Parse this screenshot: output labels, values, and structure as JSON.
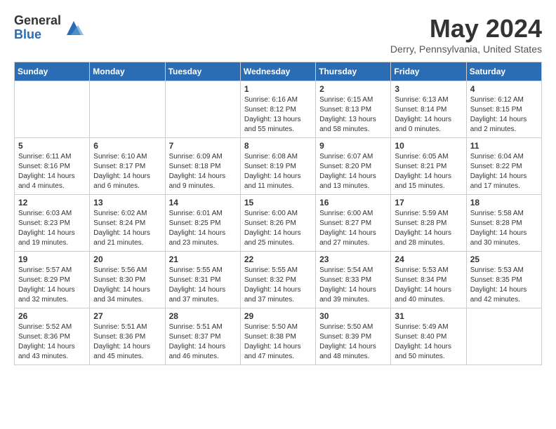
{
  "header": {
    "logo_general": "General",
    "logo_blue": "Blue",
    "title": "May 2024",
    "location": "Derry, Pennsylvania, United States"
  },
  "days_of_week": [
    "Sunday",
    "Monday",
    "Tuesday",
    "Wednesday",
    "Thursday",
    "Friday",
    "Saturday"
  ],
  "weeks": [
    [
      {
        "day": "",
        "sunrise": "",
        "sunset": "",
        "daylight": ""
      },
      {
        "day": "",
        "sunrise": "",
        "sunset": "",
        "daylight": ""
      },
      {
        "day": "",
        "sunrise": "",
        "sunset": "",
        "daylight": ""
      },
      {
        "day": "1",
        "sunrise": "Sunrise: 6:16 AM",
        "sunset": "Sunset: 8:12 PM",
        "daylight": "Daylight: 13 hours and 55 minutes."
      },
      {
        "day": "2",
        "sunrise": "Sunrise: 6:15 AM",
        "sunset": "Sunset: 8:13 PM",
        "daylight": "Daylight: 13 hours and 58 minutes."
      },
      {
        "day": "3",
        "sunrise": "Sunrise: 6:13 AM",
        "sunset": "Sunset: 8:14 PM",
        "daylight": "Daylight: 14 hours and 0 minutes."
      },
      {
        "day": "4",
        "sunrise": "Sunrise: 6:12 AM",
        "sunset": "Sunset: 8:15 PM",
        "daylight": "Daylight: 14 hours and 2 minutes."
      }
    ],
    [
      {
        "day": "5",
        "sunrise": "Sunrise: 6:11 AM",
        "sunset": "Sunset: 8:16 PM",
        "daylight": "Daylight: 14 hours and 4 minutes."
      },
      {
        "day": "6",
        "sunrise": "Sunrise: 6:10 AM",
        "sunset": "Sunset: 8:17 PM",
        "daylight": "Daylight: 14 hours and 6 minutes."
      },
      {
        "day": "7",
        "sunrise": "Sunrise: 6:09 AM",
        "sunset": "Sunset: 8:18 PM",
        "daylight": "Daylight: 14 hours and 9 minutes."
      },
      {
        "day": "8",
        "sunrise": "Sunrise: 6:08 AM",
        "sunset": "Sunset: 8:19 PM",
        "daylight": "Daylight: 14 hours and 11 minutes."
      },
      {
        "day": "9",
        "sunrise": "Sunrise: 6:07 AM",
        "sunset": "Sunset: 8:20 PM",
        "daylight": "Daylight: 14 hours and 13 minutes."
      },
      {
        "day": "10",
        "sunrise": "Sunrise: 6:05 AM",
        "sunset": "Sunset: 8:21 PM",
        "daylight": "Daylight: 14 hours and 15 minutes."
      },
      {
        "day": "11",
        "sunrise": "Sunrise: 6:04 AM",
        "sunset": "Sunset: 8:22 PM",
        "daylight": "Daylight: 14 hours and 17 minutes."
      }
    ],
    [
      {
        "day": "12",
        "sunrise": "Sunrise: 6:03 AM",
        "sunset": "Sunset: 8:23 PM",
        "daylight": "Daylight: 14 hours and 19 minutes."
      },
      {
        "day": "13",
        "sunrise": "Sunrise: 6:02 AM",
        "sunset": "Sunset: 8:24 PM",
        "daylight": "Daylight: 14 hours and 21 minutes."
      },
      {
        "day": "14",
        "sunrise": "Sunrise: 6:01 AM",
        "sunset": "Sunset: 8:25 PM",
        "daylight": "Daylight: 14 hours and 23 minutes."
      },
      {
        "day": "15",
        "sunrise": "Sunrise: 6:00 AM",
        "sunset": "Sunset: 8:26 PM",
        "daylight": "Daylight: 14 hours and 25 minutes."
      },
      {
        "day": "16",
        "sunrise": "Sunrise: 6:00 AM",
        "sunset": "Sunset: 8:27 PM",
        "daylight": "Daylight: 14 hours and 27 minutes."
      },
      {
        "day": "17",
        "sunrise": "Sunrise: 5:59 AM",
        "sunset": "Sunset: 8:28 PM",
        "daylight": "Daylight: 14 hours and 28 minutes."
      },
      {
        "day": "18",
        "sunrise": "Sunrise: 5:58 AM",
        "sunset": "Sunset: 8:28 PM",
        "daylight": "Daylight: 14 hours and 30 minutes."
      }
    ],
    [
      {
        "day": "19",
        "sunrise": "Sunrise: 5:57 AM",
        "sunset": "Sunset: 8:29 PM",
        "daylight": "Daylight: 14 hours and 32 minutes."
      },
      {
        "day": "20",
        "sunrise": "Sunrise: 5:56 AM",
        "sunset": "Sunset: 8:30 PM",
        "daylight": "Daylight: 14 hours and 34 minutes."
      },
      {
        "day": "21",
        "sunrise": "Sunrise: 5:55 AM",
        "sunset": "Sunset: 8:31 PM",
        "daylight": "Daylight: 14 hours and 37 minutes."
      },
      {
        "day": "22",
        "sunrise": "Sunrise: 5:55 AM",
        "sunset": "Sunset: 8:32 PM",
        "daylight": "Daylight: 14 hours and 37 minutes."
      },
      {
        "day": "23",
        "sunrise": "Sunrise: 5:54 AM",
        "sunset": "Sunset: 8:33 PM",
        "daylight": "Daylight: 14 hours and 39 minutes."
      },
      {
        "day": "24",
        "sunrise": "Sunrise: 5:53 AM",
        "sunset": "Sunset: 8:34 PM",
        "daylight": "Daylight: 14 hours and 40 minutes."
      },
      {
        "day": "25",
        "sunrise": "Sunrise: 5:53 AM",
        "sunset": "Sunset: 8:35 PM",
        "daylight": "Daylight: 14 hours and 42 minutes."
      }
    ],
    [
      {
        "day": "26",
        "sunrise": "Sunrise: 5:52 AM",
        "sunset": "Sunset: 8:36 PM",
        "daylight": "Daylight: 14 hours and 43 minutes."
      },
      {
        "day": "27",
        "sunrise": "Sunrise: 5:51 AM",
        "sunset": "Sunset: 8:36 PM",
        "daylight": "Daylight: 14 hours and 45 minutes."
      },
      {
        "day": "28",
        "sunrise": "Sunrise: 5:51 AM",
        "sunset": "Sunset: 8:37 PM",
        "daylight": "Daylight: 14 hours and 46 minutes."
      },
      {
        "day": "29",
        "sunrise": "Sunrise: 5:50 AM",
        "sunset": "Sunset: 8:38 PM",
        "daylight": "Daylight: 14 hours and 47 minutes."
      },
      {
        "day": "30",
        "sunrise": "Sunrise: 5:50 AM",
        "sunset": "Sunset: 8:39 PM",
        "daylight": "Daylight: 14 hours and 48 minutes."
      },
      {
        "day": "31",
        "sunrise": "Sunrise: 5:49 AM",
        "sunset": "Sunset: 8:40 PM",
        "daylight": "Daylight: 14 hours and 50 minutes."
      },
      {
        "day": "",
        "sunrise": "",
        "sunset": "",
        "daylight": ""
      }
    ]
  ]
}
